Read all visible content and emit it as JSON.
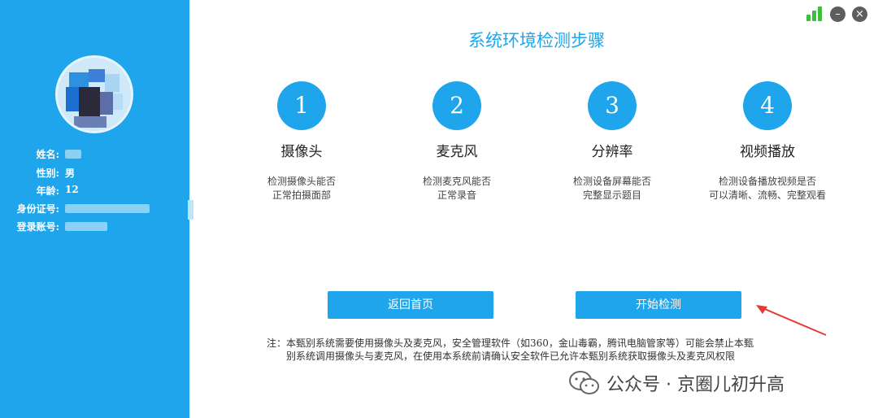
{
  "sidebar": {
    "fields": [
      {
        "label": "姓名:",
        "value": ""
      },
      {
        "label": "性别:",
        "value": "男"
      },
      {
        "label": "年龄:",
        "value": "12"
      },
      {
        "label": "身份证号:",
        "value": ""
      },
      {
        "label": "登录账号:",
        "value": ""
      }
    ]
  },
  "window": {
    "signal_icon": "signal-bars-icon",
    "minimize_label": "–",
    "close_label": "×"
  },
  "main": {
    "title": "系统环境检测步骤",
    "steps": [
      {
        "number": "1",
        "name": "摄像头",
        "desc_line1": "检测摄像头能否",
        "desc_line2": "正常拍摄面部"
      },
      {
        "number": "2",
        "name": "麦克风",
        "desc_line1": "检测麦克风能否",
        "desc_line2": "正常录音"
      },
      {
        "number": "3",
        "name": "分辨率",
        "desc_line1": "检测设备屏幕能否",
        "desc_line2": "完整显示题目"
      },
      {
        "number": "4",
        "name": "视频播放",
        "desc_line1": "检测设备播放视频是否",
        "desc_line2": "可以清晰、流畅、完整观看"
      }
    ],
    "back_button": "返回首页",
    "start_button": "开始检测",
    "note_line1": "注：本甄别系统需要使用摄像头及麦克风，安全管理软件（如360，金山毒霸，腾讯电脑管家等）可能会禁止本甄",
    "note_line2": "别系统调用摄像头与麦克风，在使用本系统前请确认安全软件已允许本甄别系统获取摄像头及麦克风权限"
  },
  "watermark": {
    "text": "公众号 · 京圈儿初升高"
  },
  "colors": {
    "accent": "#1ea5ec",
    "arrow": "#e53935",
    "signal": "#3dbf3d"
  }
}
